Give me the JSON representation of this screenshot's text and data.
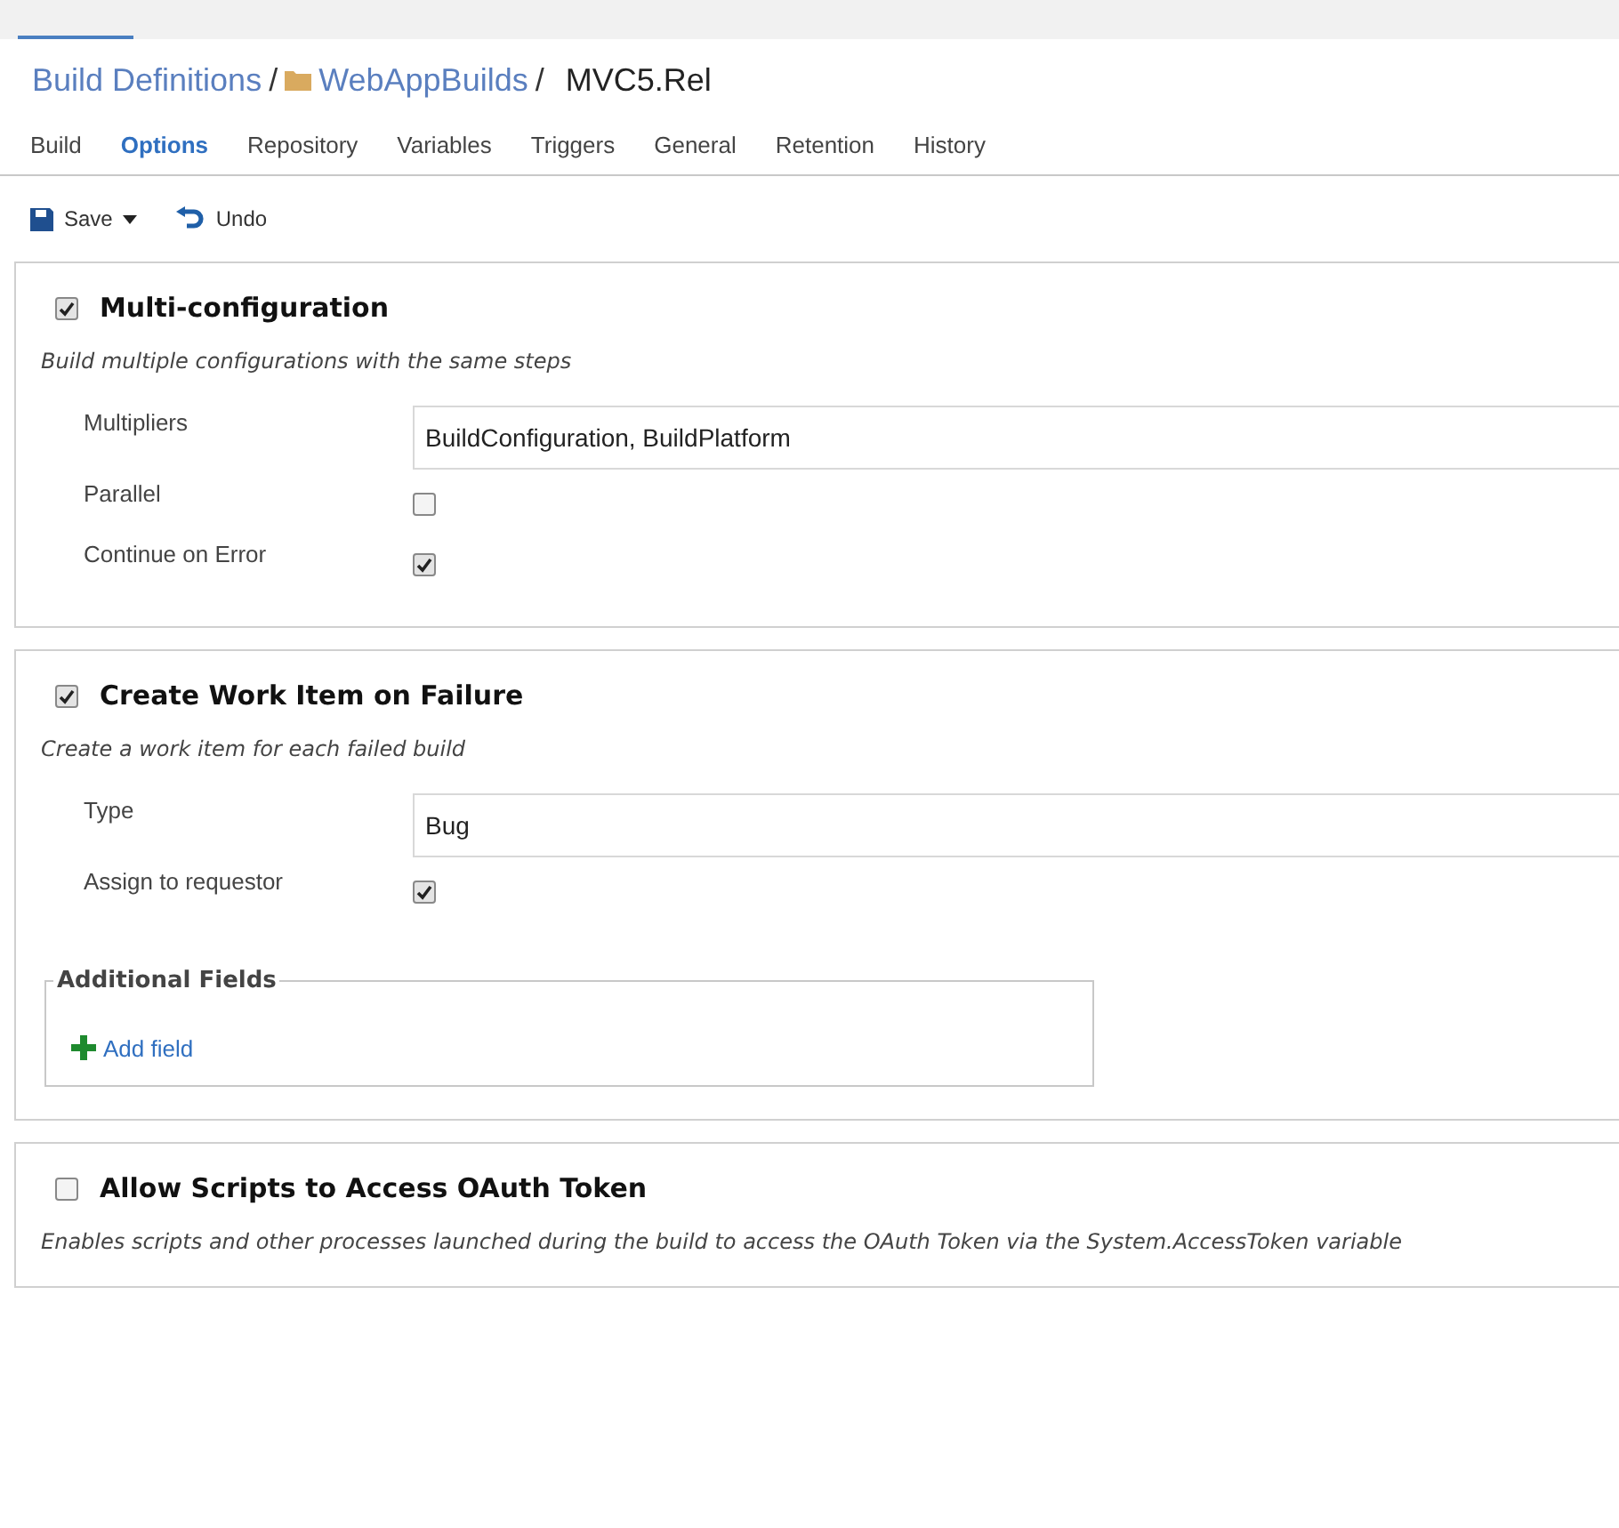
{
  "breadcrumb": {
    "root": "Build Definitions",
    "separator": "/",
    "folder": "WebAppBuilds",
    "definition": "MVC5.Rel"
  },
  "tabs": [
    {
      "label": "Build",
      "selected": false
    },
    {
      "label": "Options",
      "selected": true
    },
    {
      "label": "Repository",
      "selected": false
    },
    {
      "label": "Variables",
      "selected": false
    },
    {
      "label": "Triggers",
      "selected": false
    },
    {
      "label": "General",
      "selected": false
    },
    {
      "label": "Retention",
      "selected": false
    },
    {
      "label": "History",
      "selected": false
    }
  ],
  "toolbar": {
    "save": "Save",
    "undo": "Undo"
  },
  "sections": [
    {
      "title": "Multi-configuration",
      "checked": true,
      "description": "Build multiple configurations with the same steps",
      "fields": [
        {
          "kind": "text",
          "label": "Multipliers",
          "value": "BuildConfiguration, BuildPlatform"
        },
        {
          "kind": "checkbox",
          "label": "Parallel",
          "checked": false
        },
        {
          "kind": "checkbox",
          "label": "Continue on Error",
          "checked": true
        }
      ]
    },
    {
      "title": "Create Work Item on Failure",
      "checked": true,
      "description": "Create a work item for each failed build",
      "fields": [
        {
          "kind": "text",
          "label": "Type",
          "value": "Bug"
        },
        {
          "kind": "checkbox",
          "label": "Assign to requestor",
          "checked": true
        }
      ],
      "additional_fields": {
        "legend": "Additional Fields",
        "add_link": "Add field"
      }
    },
    {
      "title": "Allow Scripts to Access OAuth Token",
      "checked": false,
      "description": "Enables scripts and other processes launched during the build to access the OAuth Token via the System.AccessToken variable"
    }
  ]
}
